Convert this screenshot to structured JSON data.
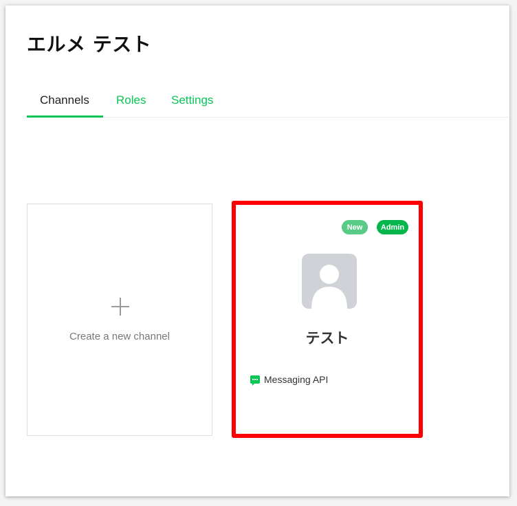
{
  "page": {
    "title": "エルメ テスト"
  },
  "tabs": [
    {
      "label": "Channels",
      "active": true
    },
    {
      "label": "Roles",
      "active": false
    },
    {
      "label": "Settings",
      "active": false
    }
  ],
  "create_card": {
    "label": "Create a new channel",
    "icon": "plus-icon"
  },
  "channel": {
    "name": "テスト",
    "badges": {
      "new": "New",
      "admin": "Admin"
    },
    "type_label": "Messaging API",
    "type_icon": "chat-bubble-icon",
    "avatar_icon": "default-user-avatar"
  },
  "colors": {
    "accent": "#06c755",
    "highlight": "#ff0000",
    "badge_new": "#58cb87",
    "badge_admin": "#06b54c"
  }
}
